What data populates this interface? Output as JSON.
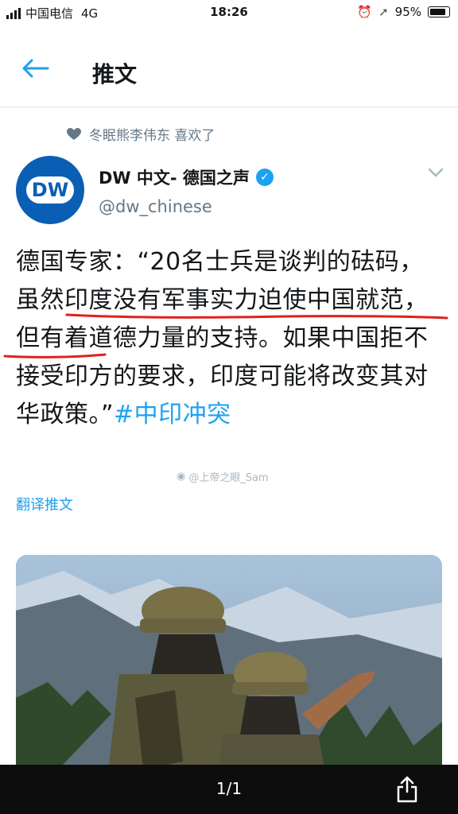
{
  "status_bar": {
    "carrier": "中国电信",
    "network": "4G",
    "time": "18:26",
    "battery_percent": "95%"
  },
  "header": {
    "title": "推文"
  },
  "tweet": {
    "liked_by": "冬眠熊李伟东 喜欢了",
    "display_name": "DW 中文- 德国之声",
    "handle": "@dw_chinese",
    "avatar_text": "DW",
    "text_parts": {
      "p1": "德国专家：“20名士兵是谈判的砝码，",
      "p2": "虽然印度没有军事实力迫使中国就范",
      "p3": "，但有着道德力量的支持。如果中国拒不接受印方的要求，印度可能将改变其对华政策。”",
      "hashtag": "#中印冲突"
    },
    "watermark": "@上帝之眼_Sam",
    "translate_label": "翻译推文"
  },
  "bottom_bar": {
    "page_indicator": "1/1"
  },
  "colors": {
    "accent": "#1da1f2",
    "dw_blue": "#0a5fb4",
    "underline_red": "#e0201c"
  }
}
